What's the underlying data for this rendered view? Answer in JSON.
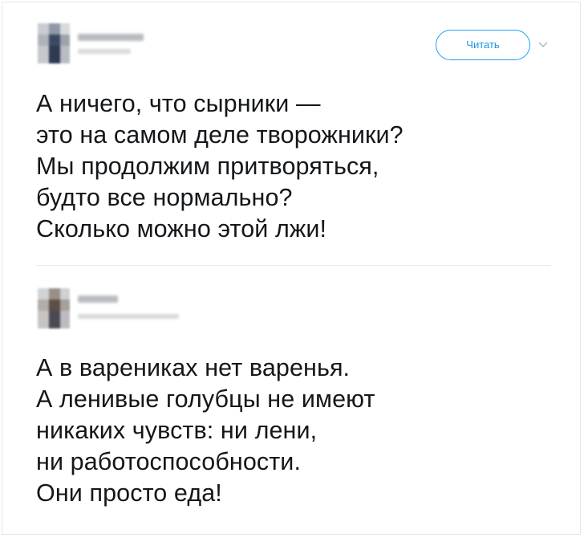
{
  "tweets": [
    {
      "follow_label": "Читать",
      "lines": [
        "А ничего, что сырники —",
        "это на самом деле творожники?",
        "Мы продолжим притворяться,",
        "будто все нормально?",
        "Сколько можно этой лжи!"
      ]
    },
    {
      "lines": [
        "А в варениках нет варенья.",
        "А ленивые голубцы не имеют",
        "никаких чувств: ни лени,",
        "ни работоспособности.",
        "Они просто еда!"
      ]
    }
  ],
  "icons": {
    "chevron": "chevron-down-icon",
    "avatar": "blurred-avatar"
  },
  "colors": {
    "accent": "#1da1f2",
    "text": "#14171a",
    "border": "#e1e8ed"
  }
}
